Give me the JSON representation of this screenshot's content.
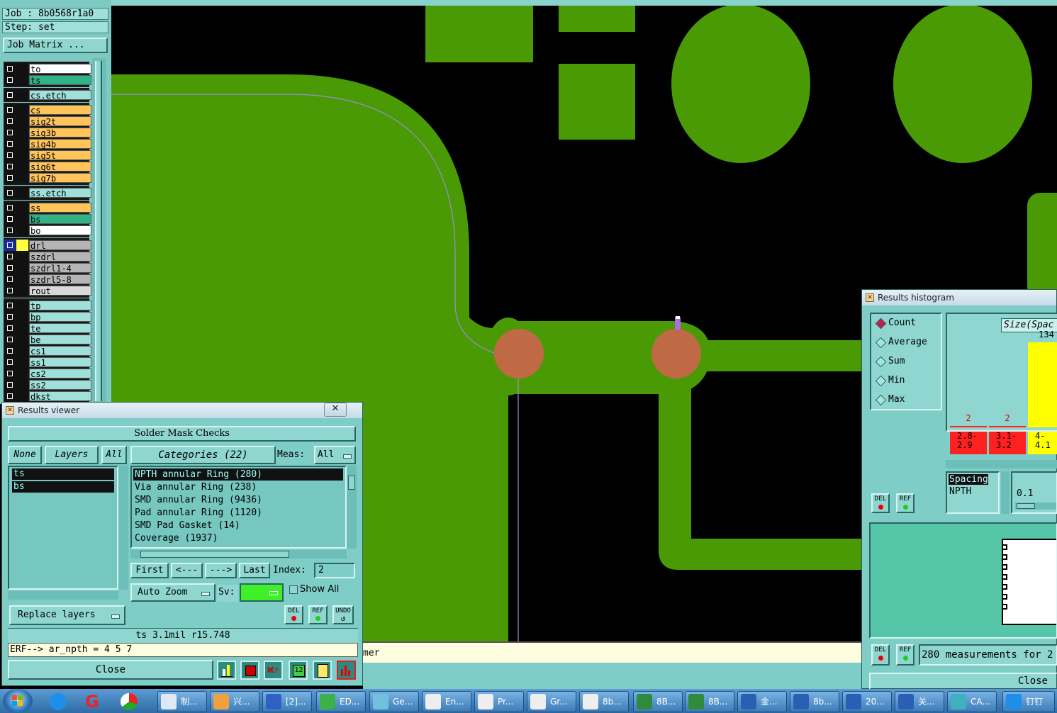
{
  "job": {
    "job_line": "Job : 8b0568r1a0",
    "step_line": "Step: set",
    "job_matrix_button": "Job Matrix ..."
  },
  "layers": [
    {
      "name": "to",
      "color": "#ffffff"
    },
    {
      "name": "ts",
      "color": "#2fb488"
    },
    {
      "name": "cs.etch",
      "color": "#9fe0da"
    },
    {
      "name": "cs",
      "color": "#ffc45a"
    },
    {
      "name": "sig2t",
      "color": "#ffc45a"
    },
    {
      "name": "sig3b",
      "color": "#ffc45a"
    },
    {
      "name": "sig4b",
      "color": "#ffc45a"
    },
    {
      "name": "sig5t",
      "color": "#ffc45a"
    },
    {
      "name": "sig6t",
      "color": "#ffc45a"
    },
    {
      "name": "sig7b",
      "color": "#ffc45a"
    },
    {
      "name": "ss.etch",
      "color": "#9fe0da"
    },
    {
      "name": "ss",
      "color": "#ffc45a"
    },
    {
      "name": "bs",
      "color": "#2fb488"
    },
    {
      "name": "bo",
      "color": "#ffffff"
    },
    {
      "name": "drl",
      "color": "#b5b5b5"
    },
    {
      "name": "szdrl",
      "color": "#b5b5b5"
    },
    {
      "name": "szdrl1-4",
      "color": "#b5b5b5"
    },
    {
      "name": "szdrl5-8",
      "color": "#b5b5b5"
    },
    {
      "name": "rout",
      "color": "#d9d9d9"
    },
    {
      "name": "tp",
      "color": "#9fe0da"
    },
    {
      "name": "bp",
      "color": "#9fe0da"
    },
    {
      "name": "te",
      "color": "#9fe0da"
    },
    {
      "name": "be",
      "color": "#9fe0da"
    },
    {
      "name": "cs1",
      "color": "#9fe0da"
    },
    {
      "name": "ss1",
      "color": "#9fe0da"
    },
    {
      "name": "cs2",
      "color": "#9fe0da"
    },
    {
      "name": "ss2",
      "color": "#9fe0da"
    },
    {
      "name": "dkst",
      "color": "#9fe0da"
    }
  ],
  "results_viewer": {
    "title": "Results viewer",
    "header": "Solder Mask Checks",
    "none_btn": "None",
    "layers_btn": "Layers",
    "all_btn": "All",
    "categories_btn": "Categories (22)",
    "meas_label": "Meas:",
    "meas_value": "All",
    "layer_list": [
      "ts",
      "bs"
    ],
    "categories": [
      "NPTH annular Ring (280)",
      "Via annular Ring (238)",
      "SMD annular Ring (9436)",
      "Pad annular Ring (1120)",
      "SMD Pad Gasket (14)",
      "Coverage (1937)"
    ],
    "first_btn": "First",
    "prev_btn": "<---",
    "next_btn": "--->",
    "last_btn": "Last",
    "index_label": "Index:",
    "index_value": "2",
    "autozoom": "Auto Zoom",
    "sv_label": "Sv:",
    "show_all": "Show All",
    "replace_layers": "Replace layers",
    "del": "DEL",
    "ref": "REF",
    "undo": "UNDO",
    "status": "ts 3.1mil  r15.748",
    "erf_line": "ERF--> ar_npth = 4 5 7",
    "close": "Close",
    "erf_tail": "mer"
  },
  "histogram": {
    "title": "Results histogram",
    "modes": [
      "Count",
      "Average",
      "Sum",
      "Min",
      "Max"
    ],
    "selected_mode": "Count",
    "size_label": "Size(Spac",
    "bars": [
      {
        "label": "2.8-\n2.9",
        "count": "2",
        "color": "#ff2020"
      },
      {
        "label": "3.1-\n3.2",
        "count": "2",
        "color": "#ff2020"
      },
      {
        "label": "4-\n4.1",
        "count": "134",
        "color": "#ffff00"
      }
    ],
    "legend_lines": [
      "Spacing",
      "NPTH"
    ],
    "scale_value": "0.1",
    "del": "DEL",
    "ref": "REF",
    "summary": "280 measurements for 2",
    "close": "Close"
  },
  "taskbar": {
    "items": [
      "制...",
      "兴...",
      "[2]...",
      "ED...",
      "Ge...",
      "En...",
      "Pr...",
      "Gr...",
      "8b...",
      "8B...",
      "8B...",
      "金...",
      "8b...",
      "20...",
      "关...",
      "CA...",
      "钉钉"
    ]
  },
  "colors": {
    "copper": "#4a9a05",
    "pad": "#c06a45",
    "panel": "#7ecdc6"
  }
}
